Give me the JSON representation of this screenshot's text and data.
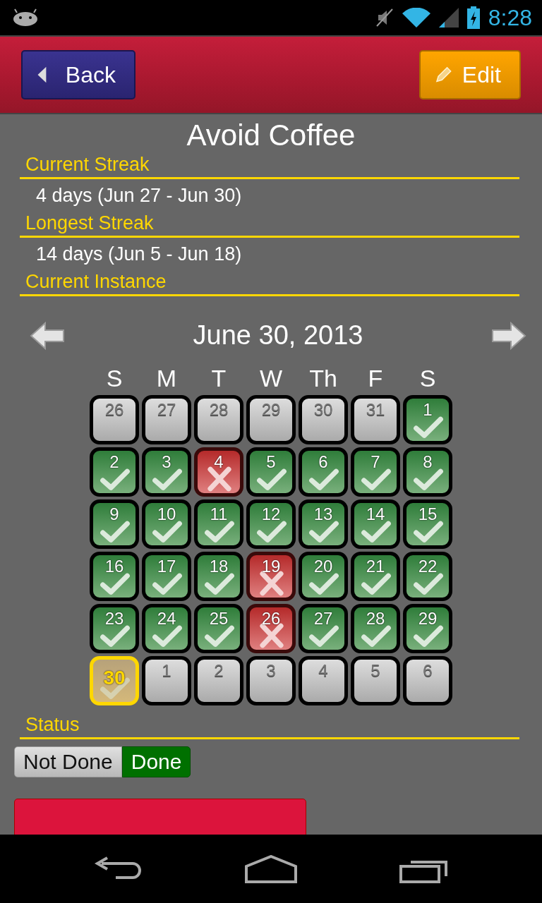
{
  "status_bar": {
    "time": "8:28"
  },
  "header": {
    "back_button": "Back",
    "edit_button": "Edit"
  },
  "title": "Avoid Coffee",
  "sections": [
    {
      "heading": "Current Streak",
      "value": "4 days (Jun 27 - Jun 30)"
    },
    {
      "heading": "Longest Streak",
      "value": "14 days (Jun 5 - Jun 18)"
    },
    {
      "heading": "Current Instance"
    }
  ],
  "calendar": {
    "month_label": "June 30, 2013",
    "weekdays": [
      "S",
      "M",
      "T",
      "W",
      "Th",
      "F",
      "S"
    ],
    "days": [
      {
        "day": "26",
        "kind": "empty",
        "selected": false
      },
      {
        "day": "27",
        "kind": "empty",
        "selected": false
      },
      {
        "day": "28",
        "kind": "empty",
        "selected": false
      },
      {
        "day": "29",
        "kind": "empty",
        "selected": false
      },
      {
        "day": "30",
        "kind": "empty",
        "selected": false
      },
      {
        "day": "31",
        "kind": "empty",
        "selected": false
      },
      {
        "day": "1",
        "kind": "done",
        "selected": false
      },
      {
        "day": "2",
        "kind": "done",
        "selected": false
      },
      {
        "day": "3",
        "kind": "done",
        "selected": false
      },
      {
        "day": "4",
        "kind": "missed",
        "selected": false
      },
      {
        "day": "5",
        "kind": "done",
        "selected": false
      },
      {
        "day": "6",
        "kind": "done",
        "selected": false
      },
      {
        "day": "7",
        "kind": "done",
        "selected": false
      },
      {
        "day": "8",
        "kind": "done",
        "selected": false
      },
      {
        "day": "9",
        "kind": "done",
        "selected": false
      },
      {
        "day": "10",
        "kind": "done",
        "selected": false
      },
      {
        "day": "11",
        "kind": "done",
        "selected": false
      },
      {
        "day": "12",
        "kind": "done",
        "selected": false
      },
      {
        "day": "13",
        "kind": "done",
        "selected": false
      },
      {
        "day": "14",
        "kind": "done",
        "selected": false
      },
      {
        "day": "15",
        "kind": "done",
        "selected": false
      },
      {
        "day": "16",
        "kind": "done",
        "selected": false
      },
      {
        "day": "17",
        "kind": "done",
        "selected": false
      },
      {
        "day": "18",
        "kind": "done",
        "selected": false
      },
      {
        "day": "19",
        "kind": "missed",
        "selected": false
      },
      {
        "day": "20",
        "kind": "done",
        "selected": false
      },
      {
        "day": "21",
        "kind": "done",
        "selected": false
      },
      {
        "day": "22",
        "kind": "done",
        "selected": false
      },
      {
        "day": "23",
        "kind": "done",
        "selected": false
      },
      {
        "day": "24",
        "kind": "done",
        "selected": false
      },
      {
        "day": "25",
        "kind": "done",
        "selected": false
      },
      {
        "day": "26",
        "kind": "missed",
        "selected": false
      },
      {
        "day": "27",
        "kind": "done",
        "selected": false
      },
      {
        "day": "28",
        "kind": "done",
        "selected": false
      },
      {
        "day": "29",
        "kind": "done",
        "selected": false
      },
      {
        "day": "30",
        "kind": "done",
        "selected": true
      },
      {
        "day": "1",
        "kind": "empty",
        "selected": false
      },
      {
        "day": "2",
        "kind": "empty",
        "selected": false
      },
      {
        "day": "3",
        "kind": "empty",
        "selected": false
      },
      {
        "day": "4",
        "kind": "empty",
        "selected": false
      },
      {
        "day": "5",
        "kind": "empty",
        "selected": false
      },
      {
        "day": "6",
        "kind": "empty",
        "selected": false
      }
    ]
  },
  "status": {
    "heading": "Status",
    "options": [
      {
        "label": "Not Done",
        "selected": false
      },
      {
        "label": "Done",
        "selected": true
      }
    ]
  }
}
